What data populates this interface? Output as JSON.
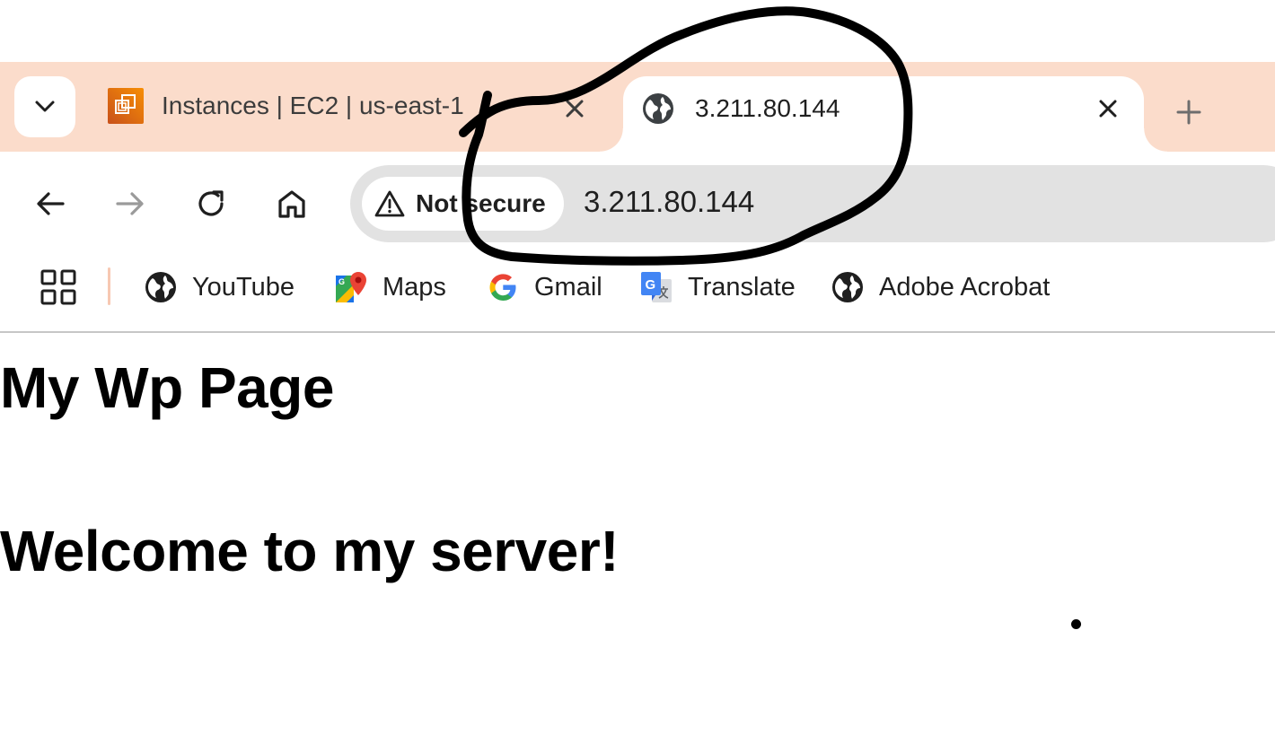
{
  "tabs": [
    {
      "title": "Instances | EC2 | us-east-1",
      "favicon": "aws-ec2-icon",
      "active": false
    },
    {
      "title": "3.211.80.144",
      "favicon": "globe-icon",
      "active": true
    }
  ],
  "toolbar": {
    "security_label": "Not secure",
    "url": "3.211.80.144"
  },
  "bookmarks": [
    {
      "label": "YouTube",
      "icon": "globe-icon"
    },
    {
      "label": "Maps",
      "icon": "google-maps-icon"
    },
    {
      "label": "Gmail",
      "icon": "google-g-icon"
    },
    {
      "label": "Translate",
      "icon": "google-translate-icon"
    },
    {
      "label": "Adobe Acrobat",
      "icon": "globe-icon"
    }
  ],
  "page": {
    "heading": "My Wp Page",
    "subheading": "Welcome to my server!"
  },
  "colors": {
    "tab_strip": "#fbdccb",
    "omnibox": "#e2e2e2",
    "annotation_ink": "#000000"
  }
}
